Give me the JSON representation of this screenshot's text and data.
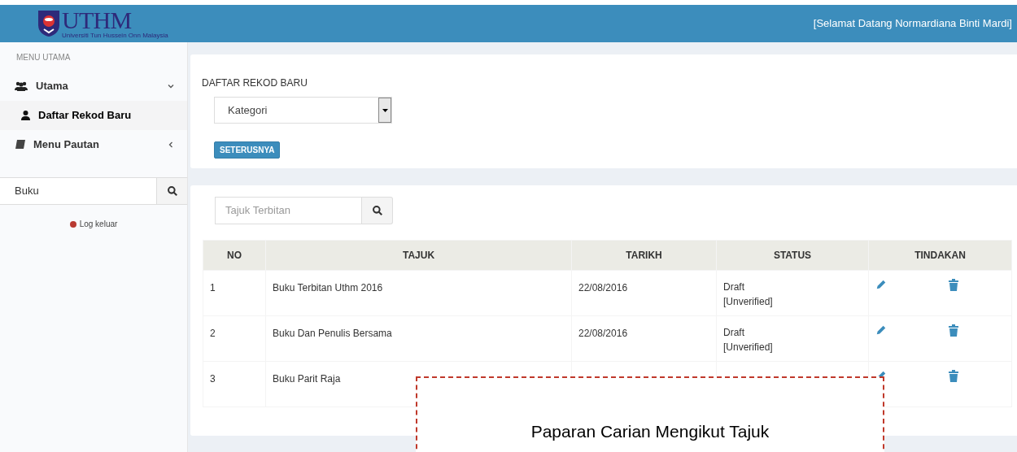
{
  "header": {
    "logo_text": "UTHM",
    "logo_subtitle": "Universiti Tun Hussein Onn Malaysia",
    "greeting": "[Selamat Datang Normardiana Binti Mardi]"
  },
  "sidebar": {
    "heading": "MENU UTAMA",
    "items": [
      {
        "label": "Utama",
        "kind": "group",
        "expanded": true,
        "selected": false,
        "children": [
          {
            "label": "Daftar Rekod Baru",
            "selected": true
          }
        ]
      },
      {
        "label": "Menu Pautan",
        "kind": "group",
        "expanded": false,
        "selected": false
      }
    ],
    "search": {
      "value": "Buku"
    },
    "logout": "Log keluar"
  },
  "register_card": {
    "title": "DAFTAR REKOD BARU",
    "select": {
      "value": "Kategori"
    },
    "button": "SETERUSNYA"
  },
  "list_card": {
    "search": {
      "placeholder": "Tajuk Terbitan"
    },
    "table": {
      "columns": [
        "NO",
        "TAJUK",
        "TARIKH",
        "STATUS",
        "TINDAKAN"
      ],
      "rows": [
        {
          "no": "1",
          "tajuk": "Buku Terbitan Uthm 2016",
          "tarikh": "22/08/2016",
          "status": [
            "Draft",
            "[Unverified]"
          ]
        },
        {
          "no": "2",
          "tajuk": "Buku Dan Penulis Bersama",
          "tarikh": "22/08/2016",
          "status": [
            "Draft",
            "[Unverified]"
          ]
        },
        {
          "no": "3",
          "tajuk": "Buku Parit Raja"
        }
      ]
    }
  },
  "callout": {
    "text": "Paparan Carian Mengikut Tajuk"
  }
}
